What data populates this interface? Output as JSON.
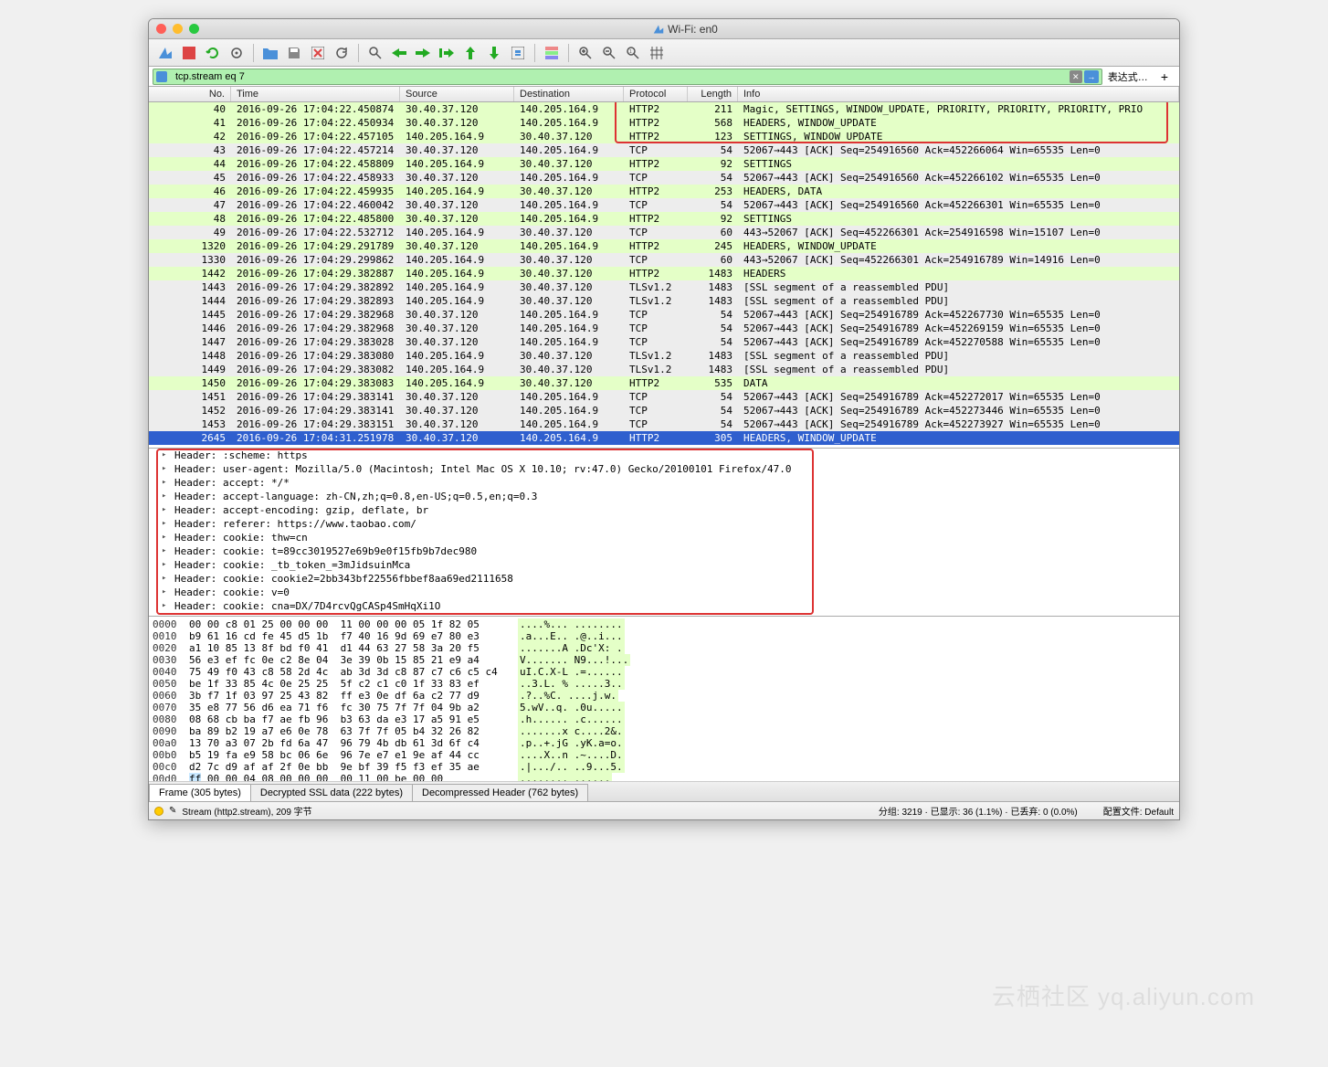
{
  "window": {
    "title": "Wi-Fi: en0"
  },
  "filter": {
    "value": "tcp.stream eq 7",
    "expr_label": "表达式…"
  },
  "columns": {
    "no": "No.",
    "time": "Time",
    "source": "Source",
    "destination": "Destination",
    "protocol": "Protocol",
    "length": "Length",
    "info": "Info"
  },
  "packets": [
    {
      "no": "40",
      "time": "2016-09-26 17:04:22.450874",
      "src": "30.40.37.120",
      "dst": "140.205.164.9",
      "proto": "HTTP2",
      "len": "211",
      "info": "Magic, SETTINGS, WINDOW_UPDATE, PRIORITY, PRIORITY, PRIORITY, PRIO",
      "cls": "green"
    },
    {
      "no": "41",
      "time": "2016-09-26 17:04:22.450934",
      "src": "30.40.37.120",
      "dst": "140.205.164.9",
      "proto": "HTTP2",
      "len": "568",
      "info": "HEADERS, WINDOW_UPDATE",
      "cls": "green"
    },
    {
      "no": "42",
      "time": "2016-09-26 17:04:22.457105",
      "src": "140.205.164.9",
      "dst": "30.40.37.120",
      "proto": "HTTP2",
      "len": "123",
      "info": "SETTINGS, WINDOW_UPDATE",
      "cls": "green"
    },
    {
      "no": "43",
      "time": "2016-09-26 17:04:22.457214",
      "src": "30.40.37.120",
      "dst": "140.205.164.9",
      "proto": "TCP",
      "len": "54",
      "info": "52067→443 [ACK] Seq=254916560 Ack=452266064 Win=65535 Len=0",
      "cls": "gray"
    },
    {
      "no": "44",
      "time": "2016-09-26 17:04:22.458809",
      "src": "140.205.164.9",
      "dst": "30.40.37.120",
      "proto": "HTTP2",
      "len": "92",
      "info": "SETTINGS",
      "cls": "green"
    },
    {
      "no": "45",
      "time": "2016-09-26 17:04:22.458933",
      "src": "30.40.37.120",
      "dst": "140.205.164.9",
      "proto": "TCP",
      "len": "54",
      "info": "52067→443 [ACK] Seq=254916560 Ack=452266102 Win=65535 Len=0",
      "cls": "gray"
    },
    {
      "no": "46",
      "time": "2016-09-26 17:04:22.459935",
      "src": "140.205.164.9",
      "dst": "30.40.37.120",
      "proto": "HTTP2",
      "len": "253",
      "info": "HEADERS, DATA",
      "cls": "green"
    },
    {
      "no": "47",
      "time": "2016-09-26 17:04:22.460042",
      "src": "30.40.37.120",
      "dst": "140.205.164.9",
      "proto": "TCP",
      "len": "54",
      "info": "52067→443 [ACK] Seq=254916560 Ack=452266301 Win=65535 Len=0",
      "cls": "gray"
    },
    {
      "no": "48",
      "time": "2016-09-26 17:04:22.485800",
      "src": "30.40.37.120",
      "dst": "140.205.164.9",
      "proto": "HTTP2",
      "len": "92",
      "info": "SETTINGS",
      "cls": "green"
    },
    {
      "no": "49",
      "time": "2016-09-26 17:04:22.532712",
      "src": "140.205.164.9",
      "dst": "30.40.37.120",
      "proto": "TCP",
      "len": "60",
      "info": "443→52067 [ACK] Seq=452266301 Ack=254916598 Win=15107 Len=0",
      "cls": "gray"
    },
    {
      "no": "1320",
      "time": "2016-09-26 17:04:29.291789",
      "src": "30.40.37.120",
      "dst": "140.205.164.9",
      "proto": "HTTP2",
      "len": "245",
      "info": "HEADERS, WINDOW_UPDATE",
      "cls": "green"
    },
    {
      "no": "1330",
      "time": "2016-09-26 17:04:29.299862",
      "src": "140.205.164.9",
      "dst": "30.40.37.120",
      "proto": "TCP",
      "len": "60",
      "info": "443→52067 [ACK] Seq=452266301 Ack=254916789 Win=14916 Len=0",
      "cls": "gray"
    },
    {
      "no": "1442",
      "time": "2016-09-26 17:04:29.382887",
      "src": "140.205.164.9",
      "dst": "30.40.37.120",
      "proto": "HTTP2",
      "len": "1483",
      "info": "HEADERS",
      "cls": "green"
    },
    {
      "no": "1443",
      "time": "2016-09-26 17:04:29.382892",
      "src": "140.205.164.9",
      "dst": "30.40.37.120",
      "proto": "TLSv1.2",
      "len": "1483",
      "info": "[SSL segment of a reassembled PDU]",
      "cls": "gray"
    },
    {
      "no": "1444",
      "time": "2016-09-26 17:04:29.382893",
      "src": "140.205.164.9",
      "dst": "30.40.37.120",
      "proto": "TLSv1.2",
      "len": "1483",
      "info": "[SSL segment of a reassembled PDU]",
      "cls": "gray"
    },
    {
      "no": "1445",
      "time": "2016-09-26 17:04:29.382968",
      "src": "30.40.37.120",
      "dst": "140.205.164.9",
      "proto": "TCP",
      "len": "54",
      "info": "52067→443 [ACK] Seq=254916789 Ack=452267730 Win=65535 Len=0",
      "cls": "gray"
    },
    {
      "no": "1446",
      "time": "2016-09-26 17:04:29.382968",
      "src": "30.40.37.120",
      "dst": "140.205.164.9",
      "proto": "TCP",
      "len": "54",
      "info": "52067→443 [ACK] Seq=254916789 Ack=452269159 Win=65535 Len=0",
      "cls": "gray"
    },
    {
      "no": "1447",
      "time": "2016-09-26 17:04:29.383028",
      "src": "30.40.37.120",
      "dst": "140.205.164.9",
      "proto": "TCP",
      "len": "54",
      "info": "52067→443 [ACK] Seq=254916789 Ack=452270588 Win=65535 Len=0",
      "cls": "gray"
    },
    {
      "no": "1448",
      "time": "2016-09-26 17:04:29.383080",
      "src": "140.205.164.9",
      "dst": "30.40.37.120",
      "proto": "TLSv1.2",
      "len": "1483",
      "info": "[SSL segment of a reassembled PDU]",
      "cls": "gray"
    },
    {
      "no": "1449",
      "time": "2016-09-26 17:04:29.383082",
      "src": "140.205.164.9",
      "dst": "30.40.37.120",
      "proto": "TLSv1.2",
      "len": "1483",
      "info": "[SSL segment of a reassembled PDU]",
      "cls": "gray"
    },
    {
      "no": "1450",
      "time": "2016-09-26 17:04:29.383083",
      "src": "140.205.164.9",
      "dst": "30.40.37.120",
      "proto": "HTTP2",
      "len": "535",
      "info": "DATA",
      "cls": "green"
    },
    {
      "no": "1451",
      "time": "2016-09-26 17:04:29.383141",
      "src": "30.40.37.120",
      "dst": "140.205.164.9",
      "proto": "TCP",
      "len": "54",
      "info": "52067→443 [ACK] Seq=254916789 Ack=452272017 Win=65535 Len=0",
      "cls": "gray"
    },
    {
      "no": "1452",
      "time": "2016-09-26 17:04:29.383141",
      "src": "30.40.37.120",
      "dst": "140.205.164.9",
      "proto": "TCP",
      "len": "54",
      "info": "52067→443 [ACK] Seq=254916789 Ack=452273446 Win=65535 Len=0",
      "cls": "gray"
    },
    {
      "no": "1453",
      "time": "2016-09-26 17:04:29.383151",
      "src": "30.40.37.120",
      "dst": "140.205.164.9",
      "proto": "TCP",
      "len": "54",
      "info": "52067→443 [ACK] Seq=254916789 Ack=452273927 Win=65535 Len=0",
      "cls": "gray"
    },
    {
      "no": "2645",
      "time": "2016-09-26 17:04:31.251978",
      "src": "30.40.37.120",
      "dst": "140.205.164.9",
      "proto": "HTTP2",
      "len": "305",
      "info": "HEADERS, WINDOW_UPDATE",
      "cls": "sel"
    }
  ],
  "details": [
    "Header: :scheme: https",
    "Header: user-agent: Mozilla/5.0 (Macintosh; Intel Mac OS X 10.10; rv:47.0) Gecko/20100101 Firefox/47.0",
    "Header: accept: */*",
    "Header: accept-language: zh-CN,zh;q=0.8,en-US;q=0.5,en;q=0.3",
    "Header: accept-encoding: gzip, deflate, br",
    "Header: referer: https://www.taobao.com/",
    "Header: cookie: thw=cn",
    "Header: cookie: t=89cc3019527e69b9e0f15fb9b7dec980",
    "Header: cookie: _tb_token_=3mJidsuinMca",
    "Header: cookie: cookie2=2bb343bf22556fbbef8aa69ed2111658",
    "Header: cookie: v=0",
    "Header: cookie: cna=DX/7D4rcvQgCASp4SmHqXi1O"
  ],
  "hex": [
    {
      "off": "0000",
      "b": "00 00 c8 01 25 00 00 00  11 00 00 00 05 1f 82 05",
      "a": "....%... ........"
    },
    {
      "off": "0010",
      "b": "b9 61 16 cd fe 45 d5 1b  f7 40 16 9d 69 e7 80 e3",
      "a": ".a...E.. .@..i..."
    },
    {
      "off": "0020",
      "b": "a1 10 85 13 8f bd f0 41  d1 44 63 27 58 3a 20 f5",
      "a": ".......A .Dc'X: ."
    },
    {
      "off": "0030",
      "b": "56 e3 ef fc 0e c2 8e 04  3e 39 0b 15 85 21 e9 a4",
      "a": "V....... N9...!..."
    },
    {
      "off": "0040",
      "b": "75 49 f0 43 c8 58 2d 4c  ab 3d 3d c8 87 c7 c6 c5 c4",
      "a": "uI.C.X-L .=......"
    },
    {
      "off": "0050",
      "b": "be 1f 33 85 4c 0e 25 25  5f c2 c1 c0 1f 33 83 ef",
      "a": "..3.L. % .....3.."
    },
    {
      "off": "0060",
      "b": "3b f7 1f 03 97 25 43 82  ff e3 0e df 6a c2 77 d9",
      "a": ".?..%C. ....j.w."
    },
    {
      "off": "0070",
      "b": "35 e8 77 56 d6 ea 71 f6  fc 30 75 7f 7f 04 9b a2",
      "a": "5.wV..q. .0u....."
    },
    {
      "off": "0080",
      "b": "08 68 cb ba f7 ae fb 96  b3 63 da e3 17 a5 91 e5",
      "a": ".h...... .c......"
    },
    {
      "off": "0090",
      "b": "ba 89 b2 19 a7 e6 0e 78  63 7f 7f 05 b4 32 26 82",
      "a": ".......x c....2&."
    },
    {
      "off": "00a0",
      "b": "13 70 a3 07 2b fd 6a 47  96 79 4b db 61 3d 6f c4",
      "a": ".p..+.jG .yK.a=o."
    },
    {
      "off": "00b0",
      "b": "b5 19 fa e9 58 bc 06 6e  96 7e e7 e1 9e af 44 cc",
      "a": "....X..n .~....D."
    },
    {
      "off": "00c0",
      "b": "d2 7c d9 af af 2f 0e bb  9e bf 39 f5 f3 ef 35 ae",
      "a": ".|.../.. ..9...5."
    },
    {
      "off": "00d0",
      "b": "ff 00 00 04 08 00 00 00  00 11 00 be 00 00",
      "a": "........ ......",
      "hl": true
    }
  ],
  "tabs": {
    "t1": "Frame (305 bytes)",
    "t2": "Decrypted SSL data (222 bytes)",
    "t3": "Decompressed Header (762 bytes)"
  },
  "status": {
    "left": "Stream (http2.stream), 209 字节",
    "center": "分组: 3219 · 已显示: 36 (1.1%) · 已丢弃: 0 (0.0%)",
    "right": "配置文件: Default"
  },
  "watermark": "云栖社区 yq.aliyun.com"
}
